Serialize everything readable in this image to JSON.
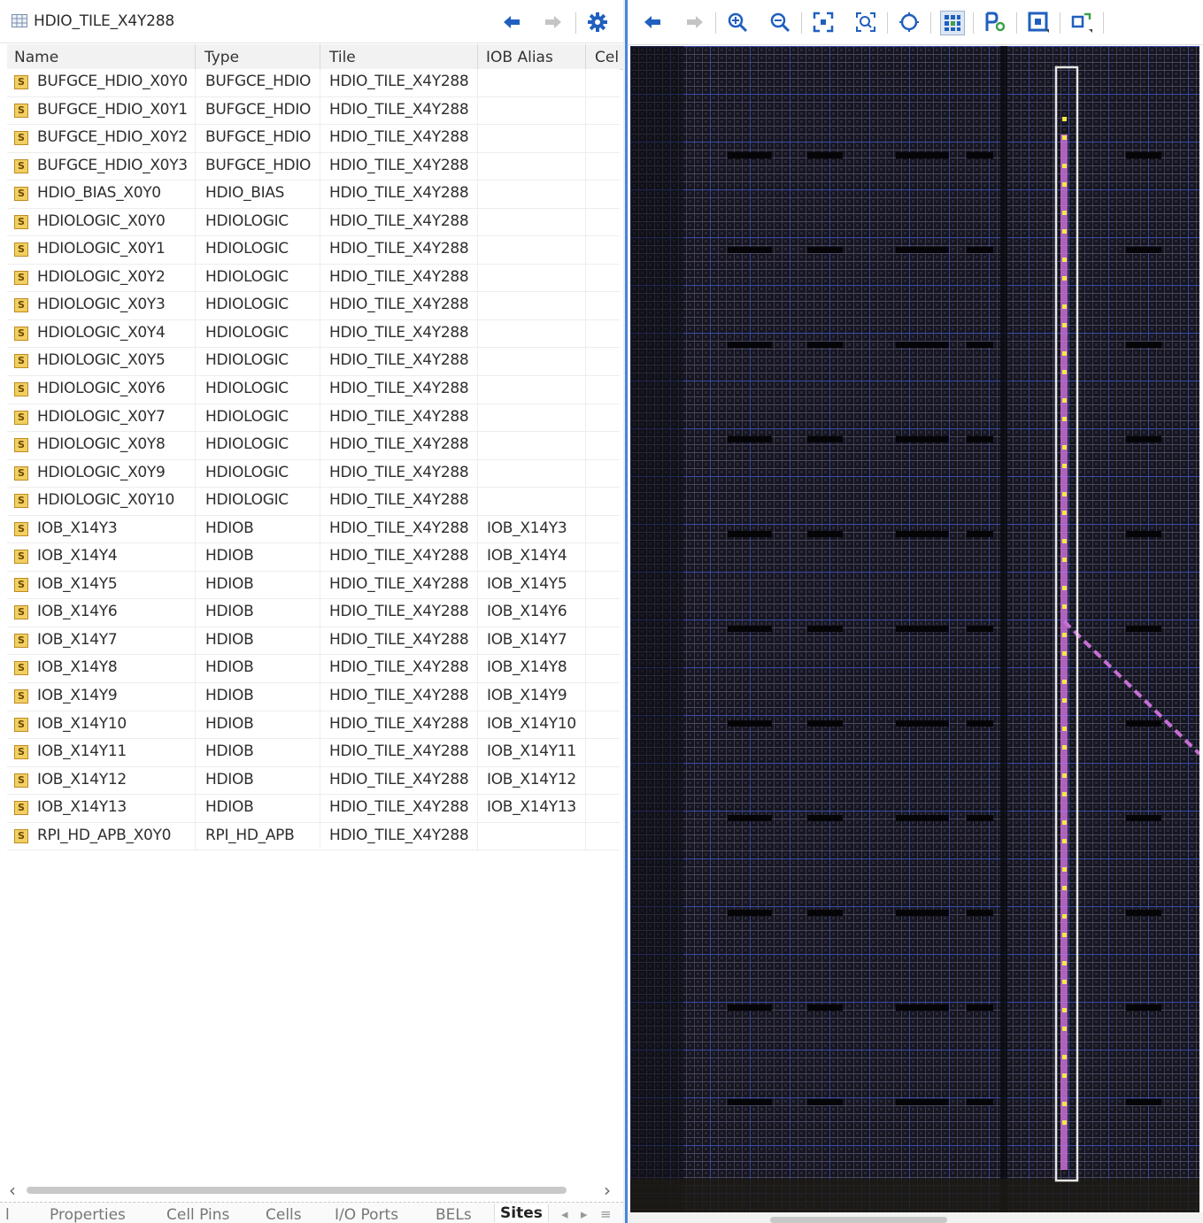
{
  "left_panel": {
    "title": "HDIO_TILE_X4Y288",
    "columns": [
      "Name",
      "Type",
      "Tile",
      "IOB Alias",
      "Cel"
    ],
    "site_icon_letter": "S",
    "rows": [
      {
        "name": "BUFGCE_HDIO_X0Y0",
        "type": "BUFGCE_HDIO",
        "tile": "HDIO_TILE_X4Y288",
        "iob_alias": ""
      },
      {
        "name": "BUFGCE_HDIO_X0Y1",
        "type": "BUFGCE_HDIO",
        "tile": "HDIO_TILE_X4Y288",
        "iob_alias": ""
      },
      {
        "name": "BUFGCE_HDIO_X0Y2",
        "type": "BUFGCE_HDIO",
        "tile": "HDIO_TILE_X4Y288",
        "iob_alias": ""
      },
      {
        "name": "BUFGCE_HDIO_X0Y3",
        "type": "BUFGCE_HDIO",
        "tile": "HDIO_TILE_X4Y288",
        "iob_alias": ""
      },
      {
        "name": "HDIO_BIAS_X0Y0",
        "type": "HDIO_BIAS",
        "tile": "HDIO_TILE_X4Y288",
        "iob_alias": ""
      },
      {
        "name": "HDIOLOGIC_X0Y0",
        "type": "HDIOLOGIC",
        "tile": "HDIO_TILE_X4Y288",
        "iob_alias": ""
      },
      {
        "name": "HDIOLOGIC_X0Y1",
        "type": "HDIOLOGIC",
        "tile": "HDIO_TILE_X4Y288",
        "iob_alias": ""
      },
      {
        "name": "HDIOLOGIC_X0Y2",
        "type": "HDIOLOGIC",
        "tile": "HDIO_TILE_X4Y288",
        "iob_alias": ""
      },
      {
        "name": "HDIOLOGIC_X0Y3",
        "type": "HDIOLOGIC",
        "tile": "HDIO_TILE_X4Y288",
        "iob_alias": ""
      },
      {
        "name": "HDIOLOGIC_X0Y4",
        "type": "HDIOLOGIC",
        "tile": "HDIO_TILE_X4Y288",
        "iob_alias": ""
      },
      {
        "name": "HDIOLOGIC_X0Y5",
        "type": "HDIOLOGIC",
        "tile": "HDIO_TILE_X4Y288",
        "iob_alias": ""
      },
      {
        "name": "HDIOLOGIC_X0Y6",
        "type": "HDIOLOGIC",
        "tile": "HDIO_TILE_X4Y288",
        "iob_alias": ""
      },
      {
        "name": "HDIOLOGIC_X0Y7",
        "type": "HDIOLOGIC",
        "tile": "HDIO_TILE_X4Y288",
        "iob_alias": ""
      },
      {
        "name": "HDIOLOGIC_X0Y8",
        "type": "HDIOLOGIC",
        "tile": "HDIO_TILE_X4Y288",
        "iob_alias": ""
      },
      {
        "name": "HDIOLOGIC_X0Y9",
        "type": "HDIOLOGIC",
        "tile": "HDIO_TILE_X4Y288",
        "iob_alias": ""
      },
      {
        "name": "HDIOLOGIC_X0Y10",
        "type": "HDIOLOGIC",
        "tile": "HDIO_TILE_X4Y288",
        "iob_alias": ""
      },
      {
        "name": "IOB_X14Y3",
        "type": "HDIOB",
        "tile": "HDIO_TILE_X4Y288",
        "iob_alias": "IOB_X14Y3"
      },
      {
        "name": "IOB_X14Y4",
        "type": "HDIOB",
        "tile": "HDIO_TILE_X4Y288",
        "iob_alias": "IOB_X14Y4"
      },
      {
        "name": "IOB_X14Y5",
        "type": "HDIOB",
        "tile": "HDIO_TILE_X4Y288",
        "iob_alias": "IOB_X14Y5"
      },
      {
        "name": "IOB_X14Y6",
        "type": "HDIOB",
        "tile": "HDIO_TILE_X4Y288",
        "iob_alias": "IOB_X14Y6"
      },
      {
        "name": "IOB_X14Y7",
        "type": "HDIOB",
        "tile": "HDIO_TILE_X4Y288",
        "iob_alias": "IOB_X14Y7"
      },
      {
        "name": "IOB_X14Y8",
        "type": "HDIOB",
        "tile": "HDIO_TILE_X4Y288",
        "iob_alias": "IOB_X14Y8"
      },
      {
        "name": "IOB_X14Y9",
        "type": "HDIOB",
        "tile": "HDIO_TILE_X4Y288",
        "iob_alias": "IOB_X14Y9"
      },
      {
        "name": "IOB_X14Y10",
        "type": "HDIOB",
        "tile": "HDIO_TILE_X4Y288",
        "iob_alias": "IOB_X14Y10"
      },
      {
        "name": "IOB_X14Y11",
        "type": "HDIOB",
        "tile": "HDIO_TILE_X4Y288",
        "iob_alias": "IOB_X14Y11"
      },
      {
        "name": "IOB_X14Y12",
        "type": "HDIOB",
        "tile": "HDIO_TILE_X4Y288",
        "iob_alias": "IOB_X14Y12"
      },
      {
        "name": "IOB_X14Y13",
        "type": "HDIOB",
        "tile": "HDIO_TILE_X4Y288",
        "iob_alias": "IOB_X14Y13"
      },
      {
        "name": "RPI_HD_APB_X0Y0",
        "type": "RPI_HD_APB",
        "tile": "HDIO_TILE_X4Y288",
        "iob_alias": ""
      }
    ],
    "tabs": {
      "partial": "l",
      "properties": "Properties",
      "cell_pins": "Cell Pins",
      "cells": "Cells",
      "io_ports": "I/O Ports",
      "bels": "BELs",
      "sites": "Sites",
      "active": "Sites"
    }
  },
  "toolbar_icons_left": [
    "back-arrow-icon",
    "forward-arrow-icon",
    "gear-icon"
  ],
  "toolbar_icons_right": [
    "back-arrow-icon",
    "forward-arrow-icon",
    "zoom-in-icon",
    "zoom-out-icon",
    "zoom-fit-icon",
    "zoom-selection-icon",
    "auto-fit-selection-icon",
    "routing-resources-icon",
    "pin-placement-icon",
    "select-area-icon",
    "more-options-icon"
  ],
  "colors": {
    "accent_blue": "#1f5fbf",
    "divider_blue": "#4a86d6",
    "device_background": "#12121a",
    "highlight_column": "#c86fd6",
    "highlight_dots": "#f3e84a",
    "site_icon": "#f1cf62"
  }
}
